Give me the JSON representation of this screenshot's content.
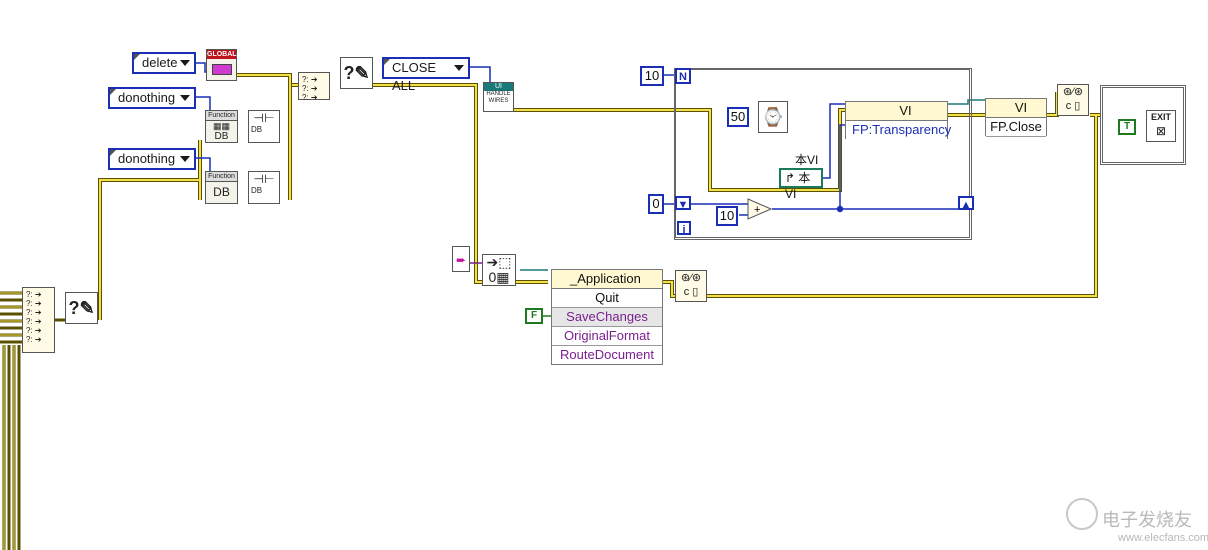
{
  "enums": {
    "delete": "delete",
    "donothing_1": "donothing",
    "donothing_2": "donothing",
    "close_all": "CLOSE ALL"
  },
  "icons": {
    "global_label": "GLOBAL",
    "function_label_1": "Function",
    "function_db_1": "DB",
    "function_label_2": "Function",
    "function_db_2": "DB",
    "db_small_1": "DB",
    "db_small_2": "DB",
    "handle_wires": "HANDLE WIRES",
    "exit_label": "EXIT"
  },
  "loop": {
    "n_value": "10",
    "n_terminal": "N",
    "i_terminal": "i",
    "wait_ms": "50",
    "shift_init": "0",
    "increment": "10"
  },
  "vi_ref": {
    "caption": "本VI",
    "constant": "本VI"
  },
  "property_node_vi": {
    "class": "VI",
    "property": "FP:Transparency"
  },
  "invoke_node_vi": {
    "class": "VI",
    "method": "FP.Close"
  },
  "app_invoke": {
    "class": "_Application",
    "method": "Quit",
    "params": [
      "SaveChanges",
      "OriginalFormat",
      "RouteDocument"
    ]
  },
  "booleans": {
    "false_const": "F",
    "true_const": "T"
  },
  "watermark": {
    "text": "电子发烧友",
    "url": "www.elecfans.com"
  }
}
